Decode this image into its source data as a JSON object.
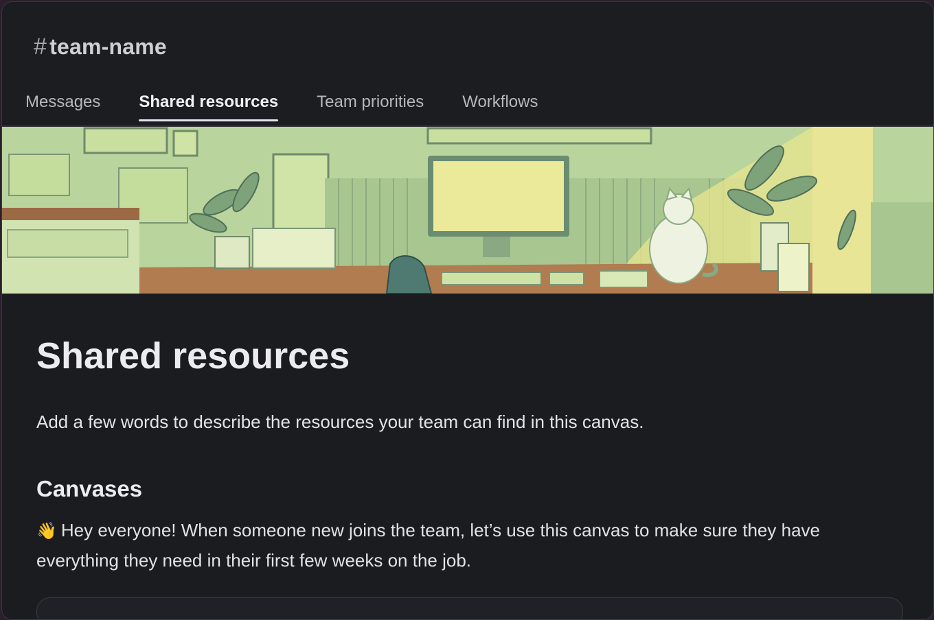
{
  "channel": {
    "hash": "#",
    "name": "team-name"
  },
  "tabs": [
    {
      "label": "Messages",
      "active": false
    },
    {
      "label": "Shared resources",
      "active": true
    },
    {
      "label": "Team priorities",
      "active": false
    },
    {
      "label": "Workflows",
      "active": false
    }
  ],
  "banner": {
    "icon": "illustration-desk-cat"
  },
  "canvas": {
    "title": "Shared resources",
    "description": "Add a few words to describe the resources your team can find in this canvas.",
    "section": {
      "heading": "Canvases",
      "emoji": "👋",
      "body": "Hey everyone! When someone new joins the team, let’s use this canvas to make sure they have everything they need in their first few weeks on the job."
    }
  },
  "colors": {
    "background": "#1b1c20",
    "active_tab_underline": "#e8e2f2",
    "banner_green": "#b7d39a"
  }
}
